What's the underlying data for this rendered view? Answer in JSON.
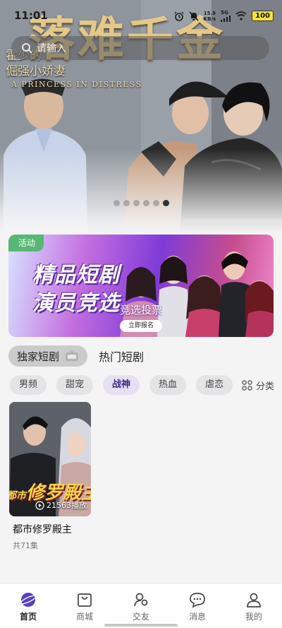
{
  "status_bar": {
    "time": "11:01",
    "net_speed_value": "15.9",
    "net_speed_unit": "KB/s",
    "signal_label": "5G",
    "battery": "100"
  },
  "hero": {
    "title": "落难千金",
    "subtitle_line1": "霍少的",
    "subtitle_line2": "倔强小娇妻",
    "english_title": "A PRINCESS IN DISTRESS",
    "slide_count": 6,
    "active_slide": 6
  },
  "search": {
    "placeholder": "请输入"
  },
  "banner": {
    "tag": "活动",
    "line1": "精品短剧",
    "line2": "演员竞选",
    "vote_text": "竞选投票",
    "cta": "立即报名"
  },
  "tabs": {
    "active": "独家短剧",
    "inactive": "热门短剧"
  },
  "categories": [
    "男频",
    "甜宠",
    "战神",
    "热血",
    "虐恋"
  ],
  "active_category": "战神",
  "category_menu": "分类",
  "cards": [
    {
      "cover_text": "修罗殿主",
      "cover_side_text": "都市",
      "plays": "21563播放",
      "title": "都市修罗殿主",
      "episodes": "共71集"
    }
  ],
  "nav": [
    {
      "label": "首页",
      "icon": "home-planet-icon",
      "active": true
    },
    {
      "label": "商城",
      "icon": "shopping-bag-icon",
      "active": false
    },
    {
      "label": "交友",
      "icon": "friends-icon",
      "active": false
    },
    {
      "label": "消息",
      "icon": "chat-bubble-icon",
      "active": false
    },
    {
      "label": "我的",
      "icon": "person-icon",
      "active": false
    }
  ],
  "colors": {
    "accent": "#5a3fc0",
    "banner_tag": "#57b773",
    "active_category_text": "#3b2a88"
  }
}
